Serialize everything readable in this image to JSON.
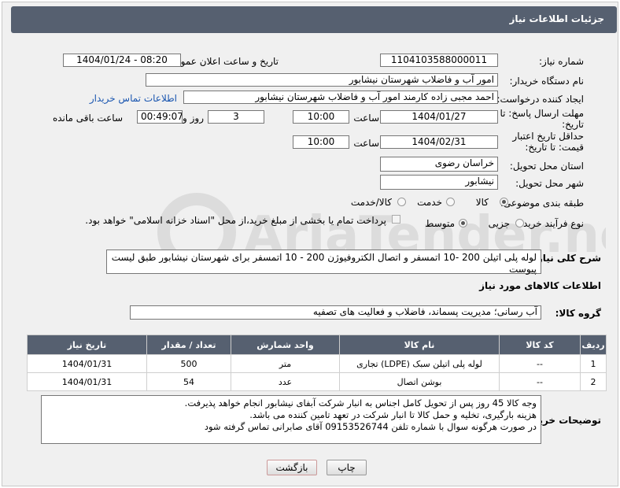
{
  "header": {
    "title": "جزئیات اطلاعات نیاز"
  },
  "fields": {
    "need_number_label": "شماره نیاز:",
    "need_number": "1104103588000011",
    "announce_label": "تاریخ و ساعت اعلان عمومی:",
    "announce_value": "1404/01/24 - 08:20",
    "buyer_org_label": "نام دستگاه خریدار:",
    "buyer_org": "امور آب و فاضلاب شهرستان نیشابور",
    "creator_label": "ایجاد کننده درخواست:",
    "creator": "احمد مجبی زاده کارمند امور آب و فاضلاب شهرستان نیشابور",
    "buyer_contact_link": "اطلاعات تماس خریدار",
    "deadline_label": "مهلت ارسال پاسخ: تا تاریخ:",
    "deadline_date": "1404/01/27",
    "time_label": "ساعت",
    "deadline_time": "10:00",
    "days_value": "3",
    "days_label": "روز و",
    "remaining_time": "00:49:07",
    "remaining_label": "ساعت باقی مانده",
    "validity_label": "حداقل تاریخ اعتبار قیمت: تا تاریخ:",
    "validity_date": "1404/02/31",
    "validity_time": "10:00",
    "province_label": "استان محل تحویل:",
    "province": "خراسان رضوی",
    "city_label": "شهر محل تحویل:",
    "city": "نیشابور",
    "category_label": "طبقه بندی موضوعی:",
    "cat_goods": "کالا",
    "cat_service": "خدمت",
    "cat_both": "کالا/خدمت",
    "process_label": "نوع فرآیند خرید :",
    "proc_minor": "جزیی",
    "proc_medium": "متوسط",
    "payment_note": "پرداخت تمام یا بخشی از مبلغ خرید،از محل \"اسناد خزانه اسلامی\" خواهد بود."
  },
  "description": {
    "label": "شرح کلی نیاز:",
    "text": "لوله پلی اتیلن 200 -10 اتمسفر و اتصال الکتروفیوژن 200  -  10 اتمسفر برای شهرستان نیشابور طبق لیست پیوست"
  },
  "goods": {
    "section_title": "اطلاعات کالاهای مورد نیاز",
    "group_label": "گروه کالا:",
    "group_value": "آب رسانی؛ مدیریت پسماند، فاضلاب و فعالیت های تصفیه",
    "columns": [
      "ردیف",
      "کد کالا",
      "نام کالا",
      "واحد شمارش",
      "تعداد / مقدار",
      "تاریخ نیاز"
    ],
    "rows": [
      {
        "row": "1",
        "code": "--",
        "name": "لوله پلی اتیلن سبک (LDPE) تجاری",
        "unit": "متر",
        "qty": "500",
        "date": "1404/01/31"
      },
      {
        "row": "2",
        "code": "--",
        "name": "بوشن اتصال",
        "unit": "عدد",
        "qty": "54",
        "date": "1404/01/31"
      }
    ]
  },
  "buyer_notes": {
    "label": "توضیحات خریدار:",
    "line1": "وجه کالا 45 روز پس از تحویل کامل اجناس به انبار شرکت آبفای نیشابور انجام خواهد پذیرفت.",
    "line2": "هزینه بارگیری، تخلیه و حمل کالا تا انبار شرکت در تعهد تامین کننده می باشد.",
    "line3": "در صورت هرگونه سوال با شماره تلفن 09153526744 آقای صابرانی تماس گرفته شود"
  },
  "buttons": {
    "print": "چاپ",
    "back": "بازگشت"
  }
}
